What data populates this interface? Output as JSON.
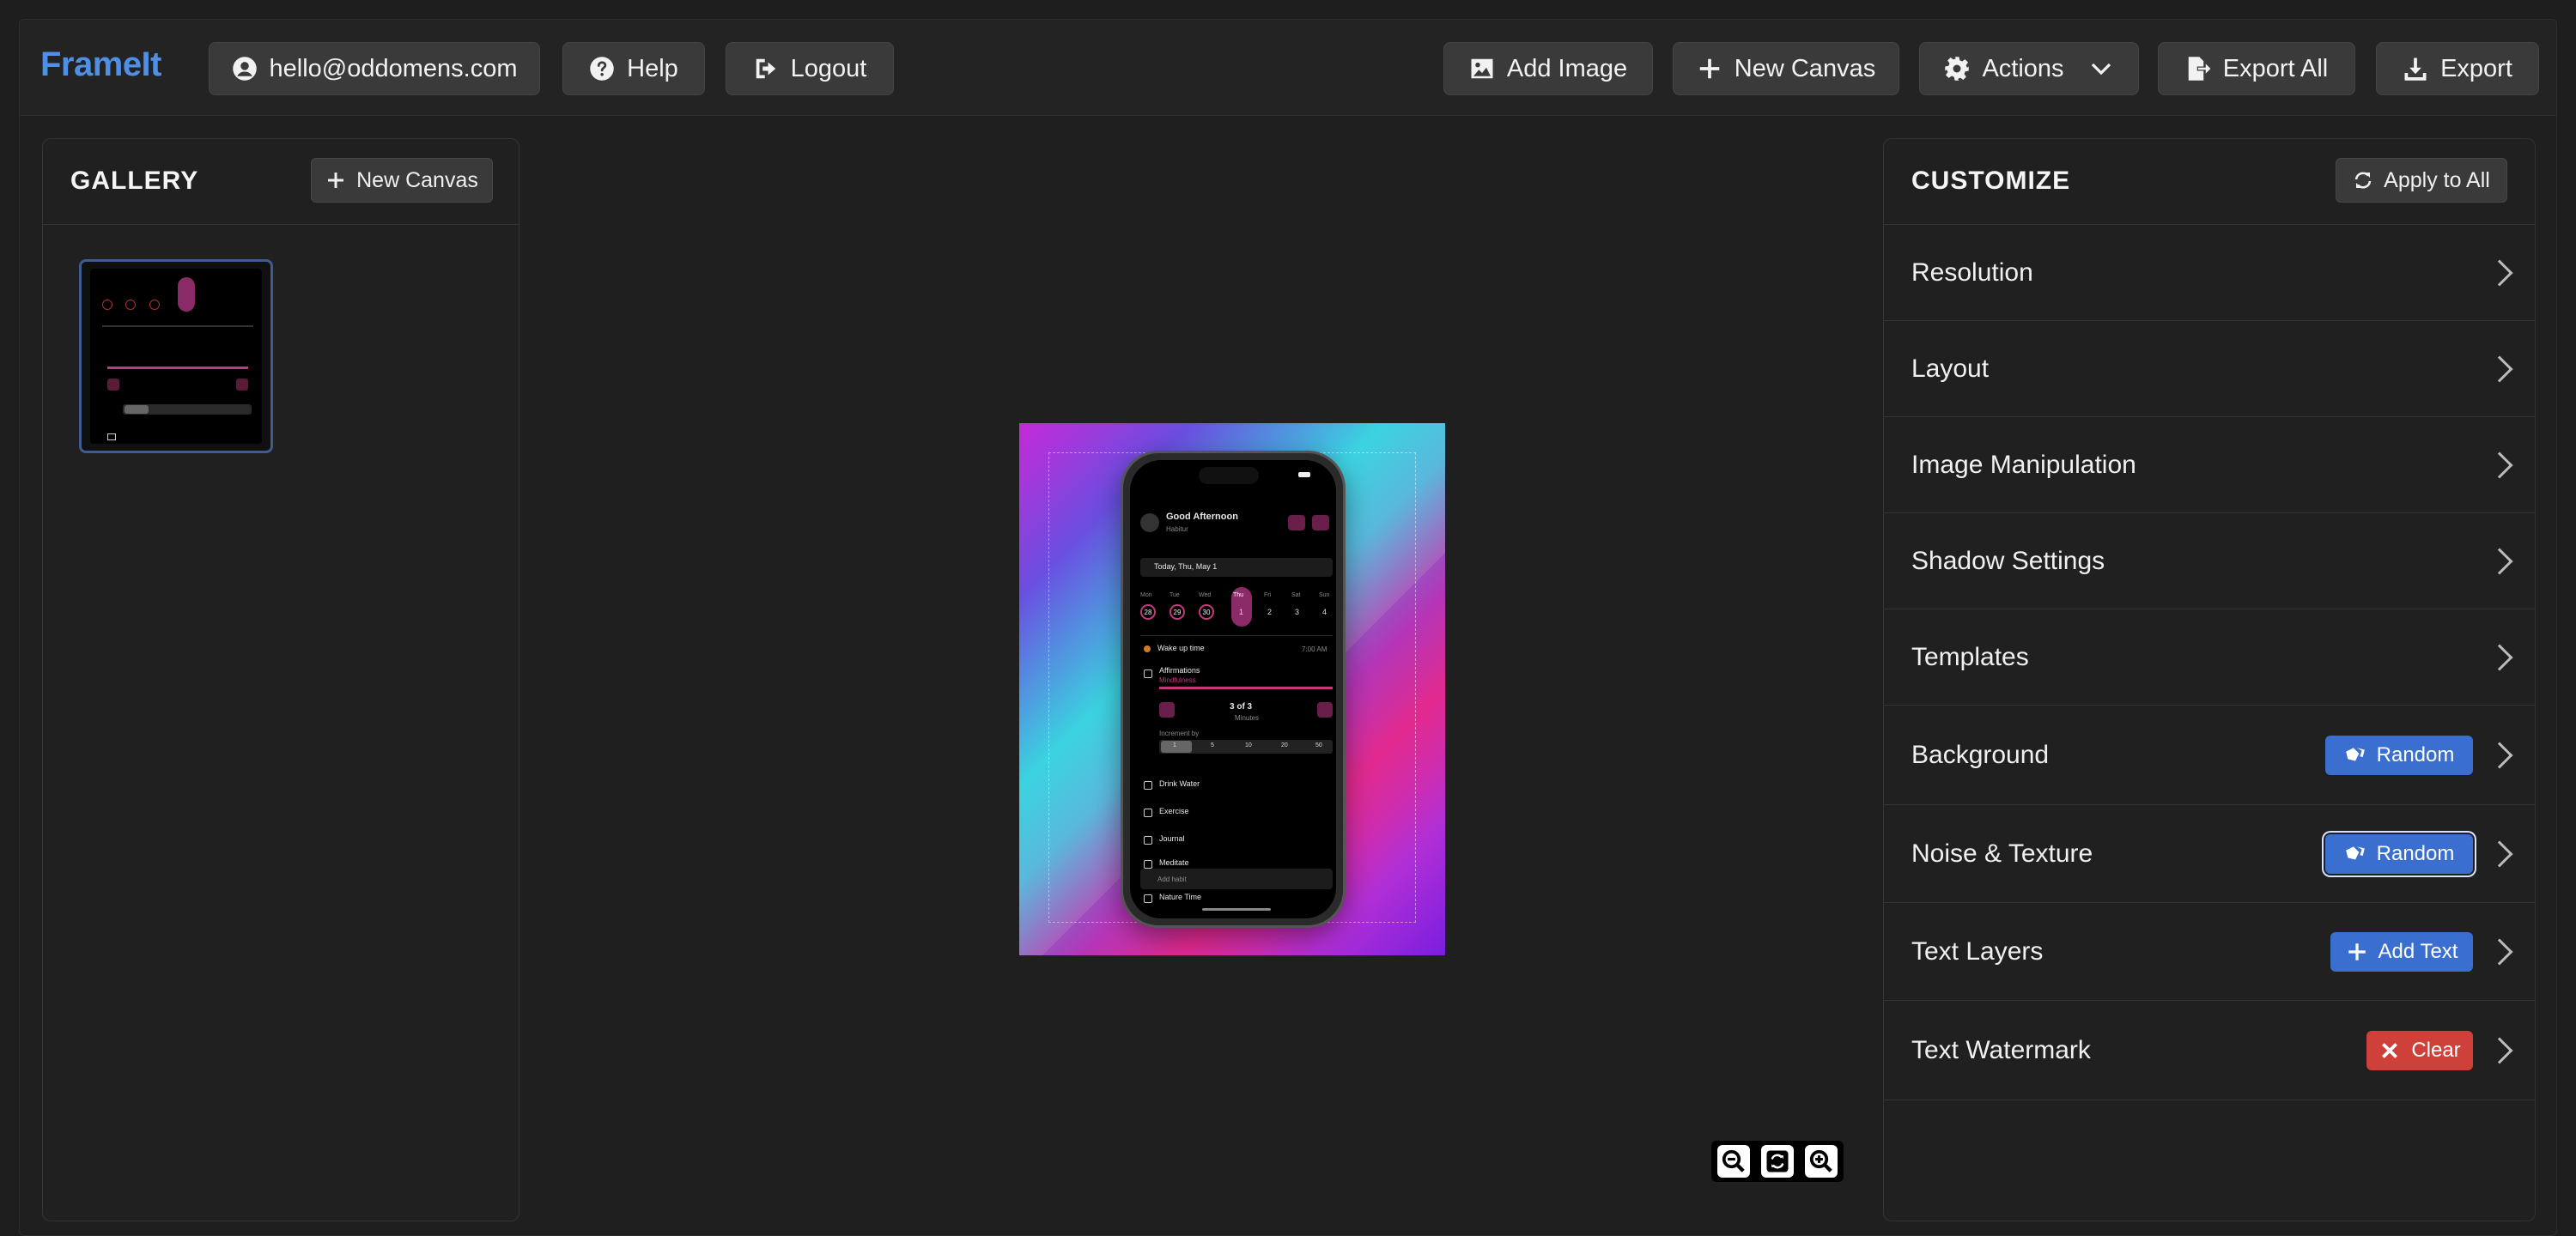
{
  "header": {
    "logo": "FrameIt",
    "account_email": "hello@oddomens.com",
    "help_label": "Help",
    "logout_label": "Logout",
    "add_image_label": "Add Image",
    "new_canvas_label": "New Canvas",
    "actions_label": "Actions",
    "export_all_label": "Export All",
    "export_label": "Export"
  },
  "gallery": {
    "title": "GALLERY",
    "new_canvas_label": "New Canvas"
  },
  "customize": {
    "title": "CUSTOMIZE",
    "apply_all_label": "Apply to All",
    "sections": [
      {
        "label": "Resolution"
      },
      {
        "label": "Layout"
      },
      {
        "label": "Image Manipulation"
      },
      {
        "label": "Shadow Settings"
      },
      {
        "label": "Templates"
      },
      {
        "label": "Background",
        "action": "Random"
      },
      {
        "label": "Noise & Texture",
        "action": "Random"
      },
      {
        "label": "Text Layers",
        "action": "Add Text"
      },
      {
        "label": "Text Watermark",
        "action": "Clear"
      }
    ]
  },
  "preview": {
    "greeting": "Good Afternoon",
    "app_name": "Habitur",
    "date": "Today, Thu, May 1",
    "weekdays": [
      "Mon",
      "Tue",
      "Wed",
      "Thu",
      "Fri",
      "Sat",
      "Sun"
    ],
    "dates": [
      "28",
      "29",
      "30",
      "1",
      "2",
      "3",
      "4"
    ],
    "wake_label": "Wake up time",
    "wake_time": "7:00 AM",
    "habit": "Affirmations",
    "habit_category": "Mindfulness",
    "counter": "3 of 3",
    "counter_unit": "Minutes",
    "increment_label": "Increment by",
    "increments": [
      "1",
      "5",
      "10",
      "20",
      "50"
    ],
    "tasks": [
      "Drink Water",
      "Exercise",
      "Journal",
      "Meditate",
      "Nature Time"
    ],
    "add_habit": "Add habit"
  },
  "icons": {
    "account": "user-circle-icon",
    "help": "question-circle-icon",
    "logout": "sign-out-icon",
    "image": "image-icon",
    "plus": "plus-icon",
    "gear": "gear-icon",
    "export_all": "file-export-icon",
    "export": "download-icon"
  },
  "colors": {
    "accent": "#4f8fe6",
    "pill_blue": "#3a6fd0",
    "pill_red": "#d0403a",
    "habit_pink": "#c23a7c"
  }
}
